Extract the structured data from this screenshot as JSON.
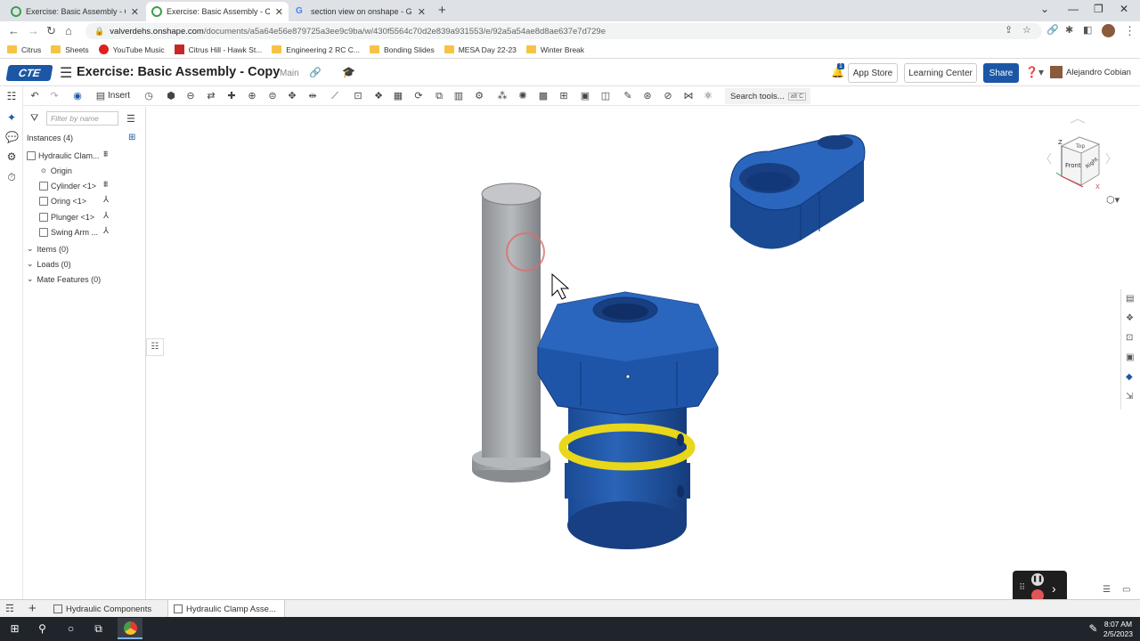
{
  "browser": {
    "tabs": [
      {
        "title": "Exercise: Basic Assembly - Copy |",
        "active": false
      },
      {
        "title": "Exercise: Basic Assembly - Copy |",
        "active": true
      },
      {
        "title": "section view on onshape - Goog",
        "active": false
      }
    ],
    "new_tab": "+",
    "url_host": "valverdehs.onshape.com",
    "url_path": "/documents/a5a64e56e879725a3ee9c9ba/w/430f5564c70d2e839a931553/e/92a5a54ae8d8ae637e7d729e",
    "bookmarks": [
      "Citrus",
      "Sheets",
      "YouTube Music",
      "Citrus Hill - Hawk St...",
      "Engineering 2 RC C...",
      "Bonding Slides",
      "MESA Day 22-23",
      "Winter Break"
    ]
  },
  "header": {
    "logo": "CTE",
    "title": "Exercise: Basic Assembly - Copy",
    "workspace": "Main",
    "notification_count": "1",
    "app_store": "App Store",
    "learning_center": "Learning Center",
    "share": "Share",
    "user": "Alejandro Cobian"
  },
  "toolbar": {
    "insert": "Insert",
    "search": "Search tools...",
    "search_kbd": "alt C"
  },
  "panel": {
    "filter_placeholder": "Filter by name",
    "instances_header": "Instances (4)",
    "tree": [
      {
        "label": "Hydraulic Clam...",
        "indent": 0
      },
      {
        "label": "Origin",
        "indent": 1
      },
      {
        "label": "Cylinder <1>",
        "indent": 1
      },
      {
        "label": "Oring <1>",
        "indent": 1
      },
      {
        "label": "Plunger <1>",
        "indent": 1
      },
      {
        "label": "Swing Arm ...",
        "indent": 1
      }
    ],
    "sections": [
      "Items (0)",
      "Loads (0)",
      "Mate Features (0)"
    ]
  },
  "viewcube": {
    "top": "Top",
    "front": "Front",
    "right": "Right"
  },
  "bottom_tabs": [
    "Hydraulic Components",
    "Hydraulic Clamp Asse..."
  ],
  "taskbar": {
    "time": "8:07 AM",
    "date": "2/5/2023"
  },
  "colors": {
    "brand_blue": "#1b57a6",
    "part_blue": "#1e4f9a",
    "part_gray": "#a8abae",
    "oring_yellow": "#e8d71a"
  }
}
